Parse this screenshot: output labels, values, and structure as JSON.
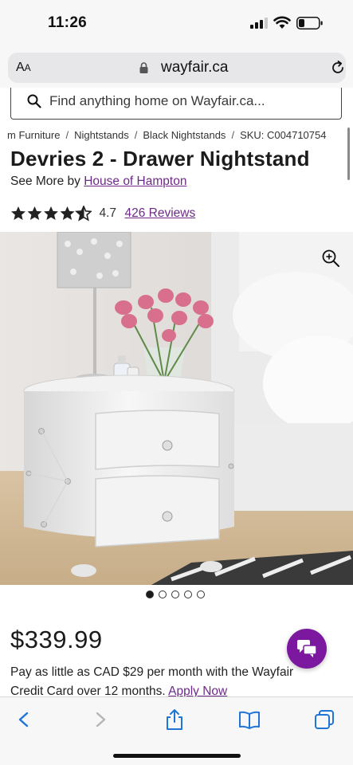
{
  "status_bar": {
    "time": "11:26"
  },
  "browser": {
    "text_size_label_big": "A",
    "text_size_label_small": "A",
    "url": "wayfair.ca"
  },
  "search": {
    "placeholder": "Find anything home on Wayfair.ca..."
  },
  "breadcrumb": {
    "items": [
      "m Furniture",
      "Nightstands",
      "Black Nightstands",
      "SKU: C004710754"
    ]
  },
  "product": {
    "title": "Devries 2 - Drawer Nightstand",
    "see_more_prefix": "See More by",
    "brand": "House of Hampton",
    "rating_value": "4.7",
    "rating_stars": 4.7,
    "reviews_label": "426 Reviews",
    "image_count": 5,
    "active_image": 1,
    "price": "$339.99",
    "financing_text": "Pay as little as CAD $29 per month with the Wayfair Credit Card over 12 months.",
    "financing_link": "Apply Now"
  },
  "colors": {
    "brand_purple": "#7b189f",
    "link_purple": "#6c2a87",
    "ios_blue": "#1f74d6"
  },
  "icons": [
    "signal-icon",
    "wifi-icon",
    "battery-icon",
    "lock-icon",
    "reload-icon",
    "search-icon",
    "star-icon",
    "zoom-in-icon",
    "chat-icon",
    "back-icon",
    "forward-icon",
    "share-icon",
    "bookmarks-icon",
    "tabs-icon"
  ]
}
